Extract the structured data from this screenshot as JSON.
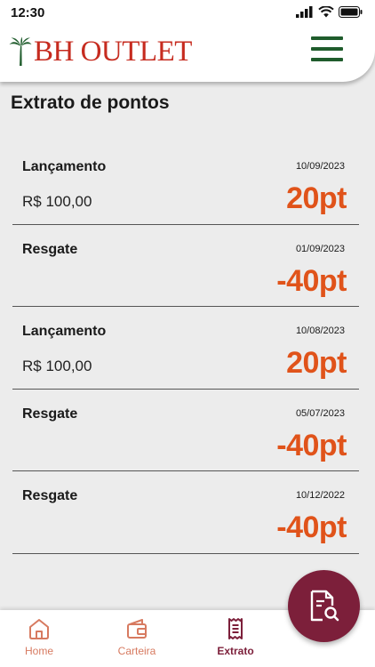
{
  "status_bar": {
    "time": "12:30"
  },
  "brand": {
    "name": "BH OUTLET",
    "color": "#c62b1f",
    "menu_color": "#1f5c2c"
  },
  "page": {
    "title": "Extrato de pontos"
  },
  "entries": [
    {
      "type": "Lançamento",
      "date": "10/09/2023",
      "value": "R$ 100,00",
      "points": "20pt"
    },
    {
      "type": "Resgate",
      "date": "01/09/2023",
      "value": "",
      "points": "-40pt"
    },
    {
      "type": "Lançamento",
      "date": "10/08/2023",
      "value": "R$ 100,00",
      "points": "20pt"
    },
    {
      "type": "Resgate",
      "date": "05/07/2023",
      "value": "",
      "points": "-40pt"
    },
    {
      "type": "Resgate",
      "date": "10/12/2022",
      "value": "",
      "points": "-40pt"
    }
  ],
  "nav": {
    "items": [
      {
        "label": "Home",
        "icon": "home-icon",
        "active": false
      },
      {
        "label": "Carteira",
        "icon": "wallet-icon",
        "active": false
      },
      {
        "label": "Extrato",
        "icon": "receipt-icon",
        "active": true
      }
    ]
  },
  "fab": {
    "icon": "document-search-icon"
  },
  "colors": {
    "accent": "#e0531a",
    "primary": "#7c1f3a",
    "inactive_nav": "#d77a60"
  }
}
